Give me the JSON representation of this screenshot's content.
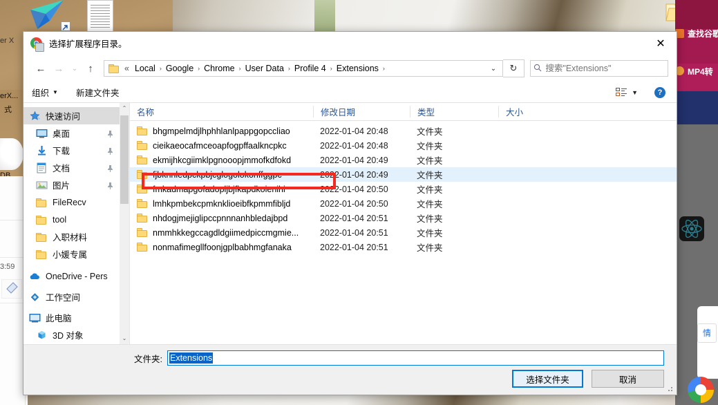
{
  "window": {
    "title": "选择扩展程序目录。",
    "app_icon": "chrome-icon",
    "close_label": "✕"
  },
  "navbar": {
    "back": "←",
    "forward": "→",
    "recent": "⌄",
    "up": "↑",
    "breadcrumb_prefix": "«",
    "breadcrumb": [
      "Local",
      "Google",
      "Chrome",
      "User Data",
      "Profile 4",
      "Extensions"
    ],
    "breadcrumb_separator": "›",
    "dropdown": "⌄",
    "refresh": "↻",
    "search_placeholder": "搜索\"Extensions\"",
    "search_value": "",
    "search_icon": "magnifier-icon"
  },
  "commandbar": {
    "organize": "组织",
    "organize_caret": "▼",
    "new_folder": "新建文件夹",
    "view_caret": "▼",
    "help": "?"
  },
  "navpane": {
    "items": [
      {
        "label": "快速访问",
        "icon": "star-icon",
        "selected": true,
        "pinned": false,
        "indent": 0
      },
      {
        "label": "桌面",
        "icon": "desktop-icon",
        "selected": false,
        "pinned": true,
        "indent": 1
      },
      {
        "label": "下载",
        "icon": "download-icon",
        "selected": false,
        "pinned": true,
        "indent": 1
      },
      {
        "label": "文档",
        "icon": "document-icon",
        "selected": false,
        "pinned": true,
        "indent": 1
      },
      {
        "label": "图片",
        "icon": "pictures-icon",
        "selected": false,
        "pinned": true,
        "indent": 1
      },
      {
        "label": "FileRecv",
        "icon": "folder-icon",
        "selected": false,
        "pinned": false,
        "indent": 1
      },
      {
        "label": "tool",
        "icon": "folder-icon",
        "selected": false,
        "pinned": false,
        "indent": 1
      },
      {
        "label": "入职材料",
        "icon": "folder-icon",
        "selected": false,
        "pinned": false,
        "indent": 1
      },
      {
        "label": "小媛专属",
        "icon": "folder-icon",
        "selected": false,
        "pinned": false,
        "indent": 1
      },
      {
        "label": "OneDrive - Pers",
        "icon": "onedrive-icon",
        "selected": false,
        "pinned": false,
        "indent": 0
      },
      {
        "label": "工作空间",
        "icon": "workspace-icon",
        "selected": false,
        "pinned": false,
        "indent": 0
      },
      {
        "label": "此电脑",
        "icon": "thispc-icon",
        "selected": false,
        "pinned": false,
        "indent": 0
      },
      {
        "label": "3D 对象",
        "icon": "3dobjects-icon",
        "selected": false,
        "pinned": false,
        "indent": 1
      }
    ],
    "scroll_up": "⌃",
    "scroll_down": "⌄"
  },
  "filelist": {
    "columns": [
      "名称",
      "修改日期",
      "类型",
      "大小"
    ],
    "sort_column": "名称",
    "sort_caret": "⌃",
    "rows": [
      {
        "name": "bhgmpelmdjlhphhlanlpappgopccliao",
        "date": "2022-01-04 20:48",
        "type": "文件夹",
        "size": "",
        "selected": false
      },
      {
        "name": "cieikaeocafmceoapfogpffaalkncpkc",
        "date": "2022-01-04 20:48",
        "type": "文件夹",
        "size": "",
        "selected": false
      },
      {
        "name": "ekmijhkcgiimklpgnooopjmmofkdfokd",
        "date": "2022-01-04 20:49",
        "type": "文件夹",
        "size": "",
        "selected": false
      },
      {
        "name": "fjbknnledpckpbjcglogolokonffggpc",
        "date": "2022-01-04 20:49",
        "type": "文件夹",
        "size": "",
        "selected": true
      },
      {
        "name": "fmkadmapgofadopljbjfkapdkoienihi",
        "date": "2022-01-04 20:50",
        "type": "文件夹",
        "size": "",
        "selected": false
      },
      {
        "name": "lmhkpmbekcpmknklioeibfkpmmfibljd",
        "date": "2022-01-04 20:50",
        "type": "文件夹",
        "size": "",
        "selected": false
      },
      {
        "name": "nhdogjmejiglipccpnnnanhbledajbpd",
        "date": "2022-01-04 20:51",
        "type": "文件夹",
        "size": "",
        "selected": false
      },
      {
        "name": "nmmhkkegccagdldgiimedpiccmgmie...",
        "date": "2022-01-04 20:51",
        "type": "文件夹",
        "size": "",
        "selected": false
      },
      {
        "name": "nonmafimegllfoonjgplbabhmgfanaka",
        "date": "2022-01-04 20:51",
        "type": "文件夹",
        "size": "",
        "selected": false
      }
    ]
  },
  "footer": {
    "folder_label": "文件夹:",
    "folder_value": "Extensions",
    "select_button": "选择文件夹",
    "cancel_button": "取消"
  },
  "annotation": {
    "highlight_color": "#f5291f",
    "target_row": "fjbknnledpckpbjcglogolokonffggpc"
  },
  "desktop": {
    "left_texts": [
      "er X",
      "erX...",
      "式",
      "DB...",
      "3:59"
    ],
    "right_panel": {
      "item1": "查找谷歌",
      "item2": "MP4转",
      "button": "情"
    }
  }
}
